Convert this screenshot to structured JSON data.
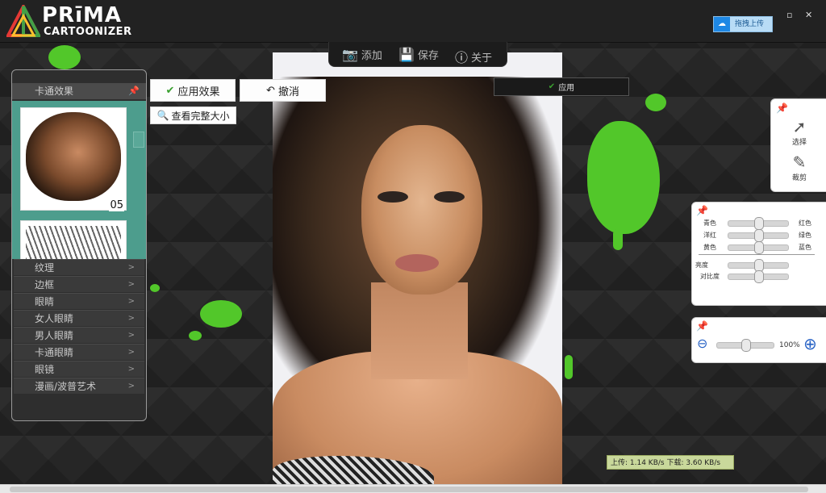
{
  "app": {
    "logo_top": "PRīMA",
    "logo_bottom": "CARTOONIZER",
    "upload_button": "拖拽上传",
    "window_restore": "▫",
    "window_close": "✕"
  },
  "toolbar": {
    "items": [
      {
        "label": "添加",
        "icon": "add-photo-icon"
      },
      {
        "label": "保存",
        "icon": "save-icon"
      },
      {
        "label": "关于",
        "icon": "info-icon"
      }
    ]
  },
  "left_panel": {
    "header": "卡通效果",
    "thumb_number": "05",
    "categories": [
      "纹理",
      "边框",
      "眼睛",
      "女人眼睛",
      "男人眼睛",
      "卡通眼睛",
      "眼镜",
      "漫画/波普艺术"
    ]
  },
  "actions": {
    "apply_effect": "应用效果",
    "undo": "撤消",
    "view_full_size": "查看完整大小",
    "apply": "应用"
  },
  "tools": {
    "select": "选择",
    "crop": "裁剪"
  },
  "color_panel": {
    "rows": [
      {
        "left": "青色",
        "right": "红色",
        "value": 0.5
      },
      {
        "left": "洋红",
        "right": "绿色",
        "value": 0.5
      },
      {
        "left": "黄色",
        "right": "蓝色",
        "value": 0.5
      }
    ],
    "brightness": {
      "label": "亮度",
      "value": 0.5
    },
    "contrast": {
      "label": "对比度",
      "value": 0.5
    }
  },
  "zoom": {
    "value_text": "100%",
    "value": 0.5
  },
  "status": {
    "text": "上传: 1.14 KB/s   下载: 3.60 KB/s"
  },
  "colors": {
    "accent_green": "#52c72a",
    "panel_teal": "#4d9d8d"
  }
}
